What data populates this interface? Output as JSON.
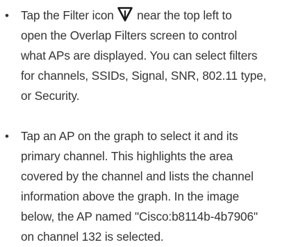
{
  "items": [
    {
      "lines": [
        {
          "before": "Tap the Filter icon ",
          "icon": "filter-icon",
          "after": " near the top left to"
        },
        "open the Overlap Filters screen to control",
        "what APs are displayed. You can select filters",
        "for channels, SSIDs, Signal, SNR, 802.11 type,",
        "or Security."
      ]
    },
    {
      "lines": [
        "Tap an AP on the graph to select it and its",
        "primary channel. This highlights the area",
        "covered by the channel and lists the channel",
        "information above the graph. In the image",
        "below, the AP named \"Cisco:b8114b-4b7906\"",
        "on channel 132 is selected."
      ]
    }
  ],
  "bullet_glyph": "•"
}
